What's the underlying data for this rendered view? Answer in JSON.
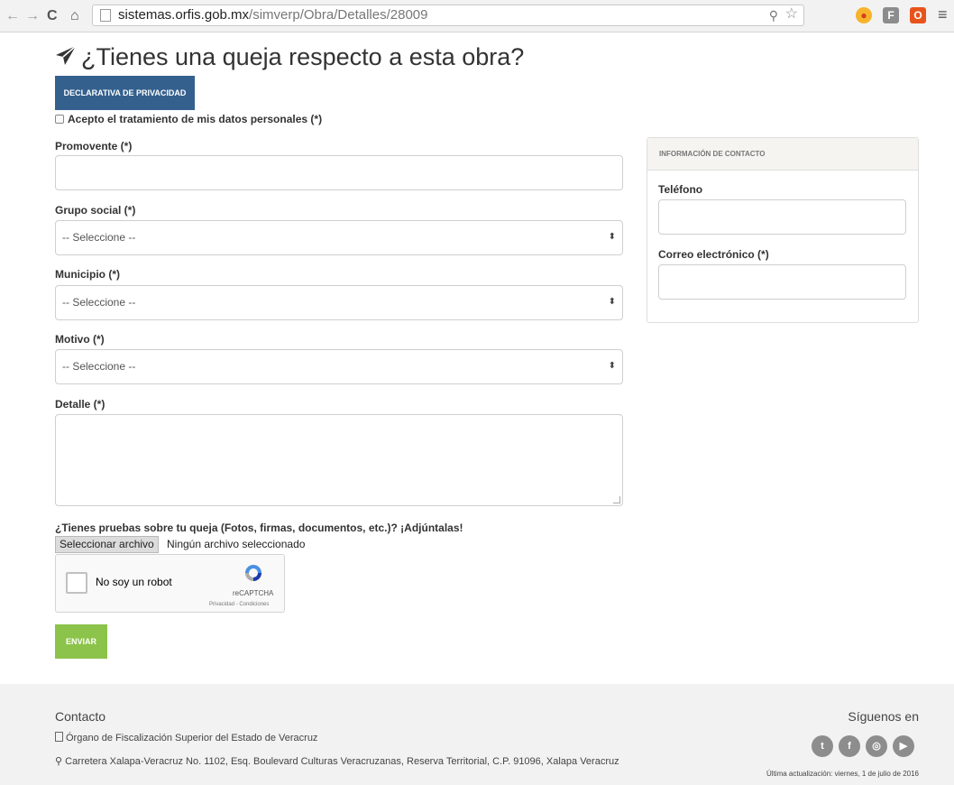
{
  "browser": {
    "url_host": "sistemas.orfis.gob.mx",
    "url_path": "/simverp/Obra/Detalles/28009"
  },
  "page": {
    "title": "¿Tienes una queja respecto a esta obra?",
    "privacy_button": "DECLARATIVA DE PRIVACIDAD",
    "consent_label": "Acepto el tratamiento de mis datos personales (*)"
  },
  "form": {
    "promovente_label": "Promovente (*)",
    "grupo_label": "Grupo social (*)",
    "grupo_value": "-- Seleccione --",
    "municipio_label": "Municipio (*)",
    "municipio_value": "-- Seleccione --",
    "motivo_label": "Motivo (*)",
    "motivo_value": "-- Seleccione --",
    "detalle_label": "Detalle (*)",
    "attach_label": "¿Tienes pruebas sobre tu queja (Fotos, firmas, documentos, etc.)? ¡Adjúntalas!",
    "file_button": "Seleccionar archivo",
    "file_status": "Ningún archivo seleccionado",
    "captcha_label": "No soy un robot",
    "captcha_brand": "reCAPTCHA",
    "captcha_links": "Privacidad - Condiciones",
    "submit": "ENVIAR"
  },
  "contact_panel": {
    "heading": "INFORMACIÓN DE CONTACTO",
    "phone_label": "Teléfono",
    "email_label": "Correo electrónico (*)"
  },
  "footer": {
    "contact_title": "Contacto",
    "org": "Órgano de Fiscalización Superior del Estado de Veracruz",
    "address": "Carretera Xalapa-Veracruz No. 1102, Esq. Boulevard Culturas Veracruzanas, Reserva Territorial, C.P. 91096, Xalapa Veracruz",
    "follow": "Síguenos en",
    "updated": "Última actualización: viernes, 1 de julio de 2016",
    "social": [
      "twitter-icon",
      "facebook-icon",
      "instagram-icon",
      "youtube-icon"
    ]
  },
  "colors": {
    "privacy_button": "#34608e",
    "submit_button": "#8cc34a",
    "footer_bg": "#f2f2f2"
  }
}
